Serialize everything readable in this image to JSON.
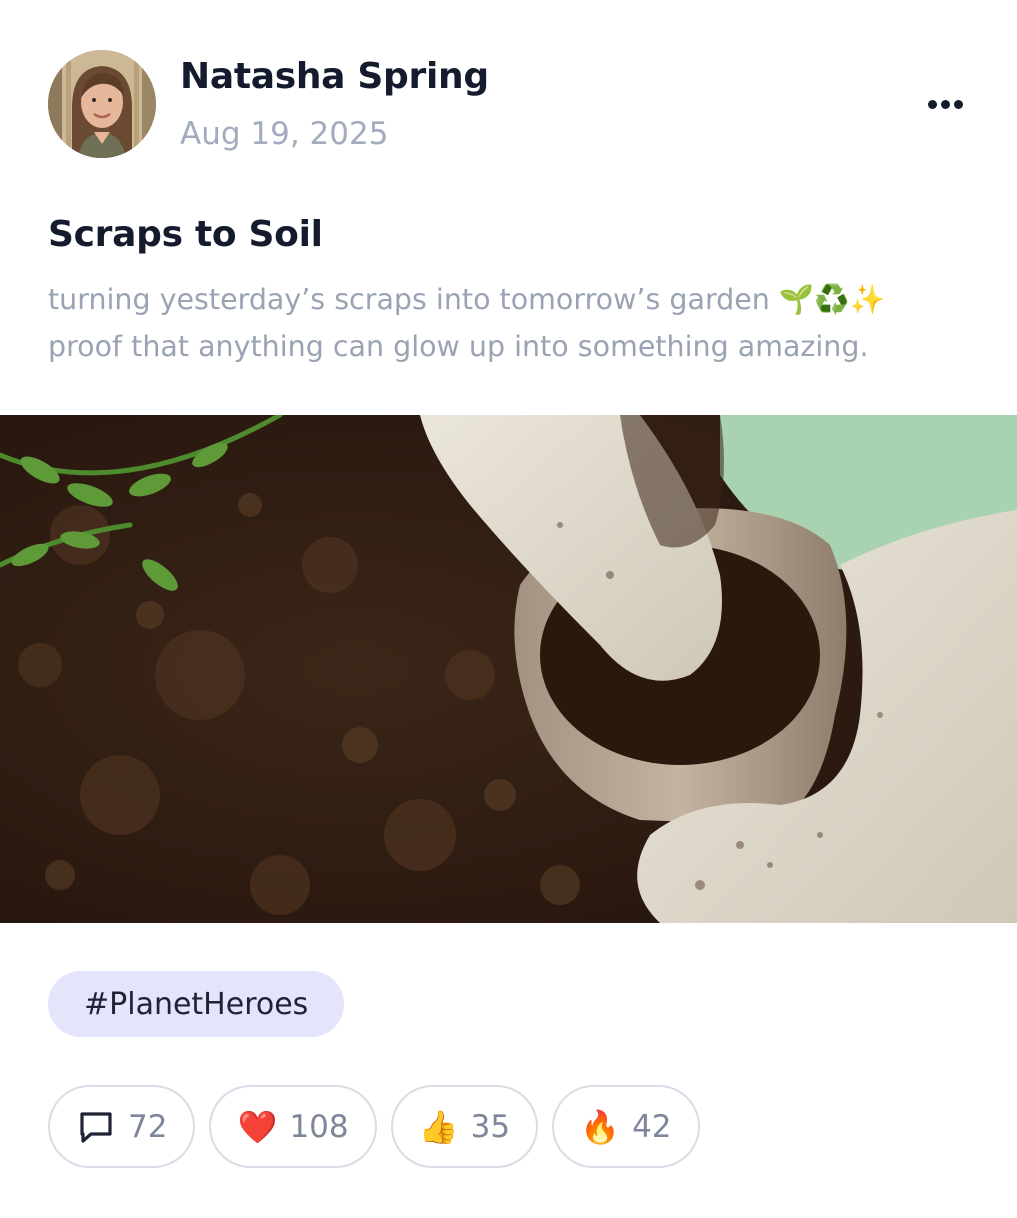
{
  "author": {
    "name": "Natasha Spring",
    "date": "Aug 19, 2025",
    "avatar_icon": "avatar-photo"
  },
  "menu": {
    "icon": "more-horizontal-icon"
  },
  "post": {
    "title": "Scraps to Soil",
    "body_lines": [
      "turning yesterday’s scraps into tomorrow’s garden 🌱♻️✨",
      "proof that anything can glow up into something amazing."
    ],
    "image_icon": "gloved-hands-planting-seedling-pot-photo"
  },
  "hashtag": "#PlanetHeroes",
  "reactions": [
    {
      "icon": "comment-icon",
      "glyph": "",
      "count": "72"
    },
    {
      "icon": "heart-icon",
      "glyph": "❤️",
      "count": "108"
    },
    {
      "icon": "thumbs-up-icon",
      "glyph": "👍",
      "count": "35"
    },
    {
      "icon": "fire-icon",
      "glyph": "🔥",
      "count": "42"
    }
  ],
  "colors": {
    "text_primary": "#141b2d",
    "text_muted": "#9aa3b4",
    "hashtag_bg": "#e4e4fb",
    "pill_border": "#d8dce5"
  }
}
